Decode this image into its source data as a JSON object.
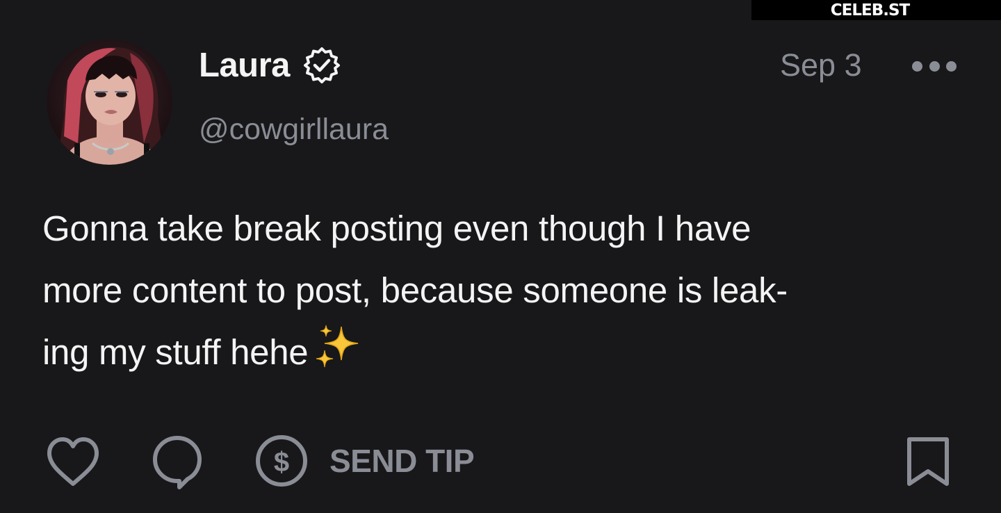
{
  "watermark": {
    "text": "CELEB.ST"
  },
  "post": {
    "author": {
      "display_name": "Laura",
      "handle": "@cowgirllaura",
      "verified": true
    },
    "date": "Sep 3",
    "text": "Gonna take break posting even though I have more content to post, because someone is leak-ing my stuff hehe",
    "text_lines": [
      "Gonna take break posting even though I have",
      "more content to post, because someone is leak-",
      "ing my stuff hehe"
    ],
    "emoji": "sparkles"
  },
  "actions": {
    "like_icon": "heart-icon",
    "comment_icon": "comment-icon",
    "tip_icon": "dollar-circle-icon",
    "tip_label": "SEND TIP",
    "bookmark_icon": "bookmark-icon"
  },
  "colors": {
    "background": "#18181a",
    "text_primary": "#f4f4f5",
    "text_muted": "#8a8d95",
    "watermark_bg": "#000000"
  }
}
